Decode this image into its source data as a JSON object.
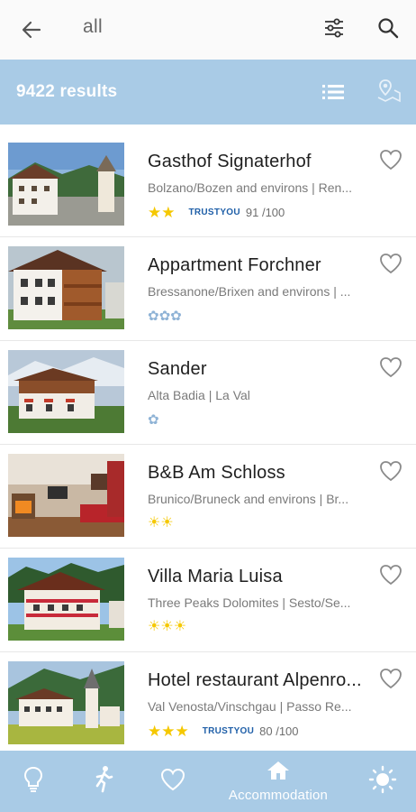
{
  "header": {
    "back_icon": "arrow-left-icon",
    "query": "all",
    "filter_icon": "sliders-icon",
    "search_icon": "search-icon"
  },
  "results": {
    "count_label": "9422 results",
    "list_icon": "list-view-icon",
    "map_icon": "map-pin-icon",
    "bar_color": "#a9cbe6"
  },
  "listings": [
    {
      "name": "Gasthof Signaterhof",
      "location": "Bolzano/Bozen and environs | Ren...",
      "rating_type": "stars",
      "rating_count": 2,
      "rating_symbol": "★★",
      "trustyou": true,
      "trust_logo": "TRUSTYOU",
      "trust_score": "91 /100"
    },
    {
      "name": "Appartment Forchner",
      "location": "Bressanone/Brixen and environs | ...",
      "rating_type": "flowers",
      "rating_count": 3,
      "rating_symbol": "✿✿✿",
      "trustyou": false
    },
    {
      "name": "Sander",
      "location": "Alta Badia | La Val",
      "rating_type": "flowers",
      "rating_count": 1,
      "rating_symbol": "✿",
      "trustyou": false
    },
    {
      "name": "B&B Am Schloss",
      "location": "Brunico/Bruneck and environs | Br...",
      "rating_type": "suns",
      "rating_count": 2,
      "rating_symbol": "☀☀",
      "trustyou": false
    },
    {
      "name": "Villa Maria Luisa",
      "location": "Three Peaks Dolomites | Sesto/Se...",
      "rating_type": "suns",
      "rating_count": 3,
      "rating_symbol": "☀☀☀",
      "trustyou": false
    },
    {
      "name": "Hotel restaurant  Alpenro...",
      "location": "Val Venosta/Vinschgau | Passo Re...",
      "rating_type": "stars",
      "rating_count": 3,
      "rating_symbol": "★★★",
      "trustyou": true,
      "trust_logo": "TRUSTYOU",
      "trust_score": "80 /100"
    }
  ],
  "bottom_nav": {
    "items": [
      {
        "icon": "lightbulb-icon",
        "label": ""
      },
      {
        "icon": "walking-person-icon",
        "label": ""
      },
      {
        "icon": "heart-icon",
        "label": ""
      },
      {
        "icon": "house-icon",
        "label": "Accommodation",
        "active": true
      },
      {
        "icon": "sun-icon",
        "label": ""
      }
    ]
  },
  "colors": {
    "accent": "#a9cbe6",
    "rating_gold": "#f5c800",
    "text_secondary": "#7a7a7a"
  }
}
